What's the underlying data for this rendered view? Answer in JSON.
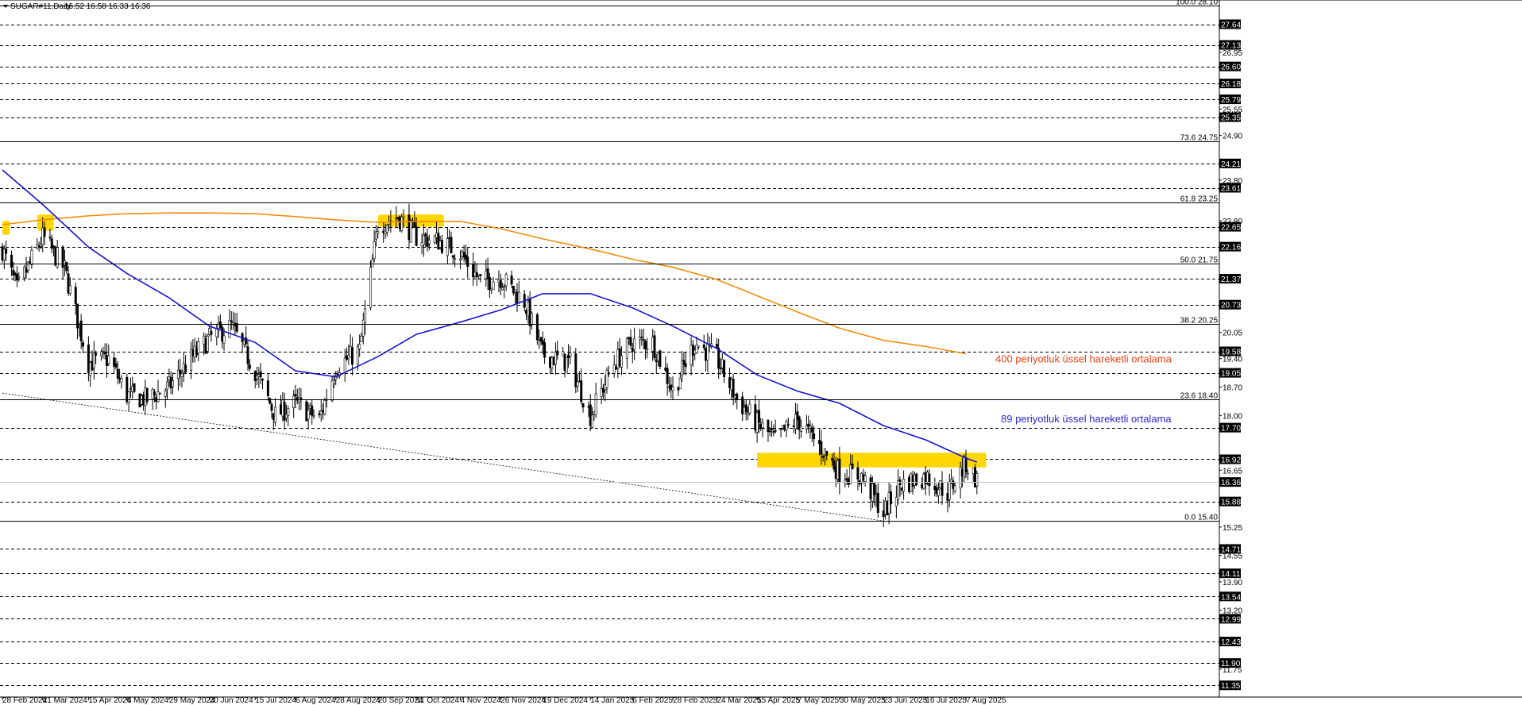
{
  "header": {
    "symbol": "SUGAR#11,Daily",
    "ohlc": "16.52 16.58 16.33 16.36"
  },
  "colors": {
    "background": "#ffffff",
    "grid": "#000000",
    "ema89": "#1414d2",
    "ema400": "#f28c0c",
    "zone": "#ffd600",
    "price_box": "#000000",
    "ann89": "#2a2ad4",
    "ann400": "#f2400f"
  },
  "chart_data": {
    "type": "candlestick",
    "title": "SUGAR#11,Daily",
    "ylim": [
      11.1,
      28.1
    ],
    "dates": [
      "28 Feb 2024",
      "21 Mar 2024",
      "15 Apr 2024",
      "6 May 2024",
      "29 May 2024",
      "20 Jun 2024",
      "15 Jul 2024",
      "6 Aug 2024",
      "28 Aug 2024",
      "20 Sep 2024",
      "11 Oct 2024",
      "4 Nov 2024",
      "26 Nov 2024",
      "19 Dec 2024",
      "14 Jan 2025",
      "6 Feb 2025",
      "28 Feb 2025",
      "24 Mar 2025",
      "15 Apr 2025",
      "7 May 2025",
      "30 May 2025",
      "23 Jun 2025",
      "16 Jul 2025",
      "7 Aug 2025"
    ],
    "y_ticks_dashed": [
      27.64,
      27.13,
      26.6,
      26.18,
      25.79,
      25.35,
      24.21,
      23.61,
      22.65,
      22.16,
      21.37,
      20.73,
      19.58,
      19.05,
      17.7,
      16.92,
      15.88,
      14.71,
      14.11,
      13.54,
      12.99,
      12.43,
      11.9,
      11.35
    ],
    "y_ticks_minor": [
      26.95,
      25.55,
      24.9,
      23.8,
      22.8,
      20.05,
      19.4,
      18.7,
      18.0,
      16.65,
      15.25,
      14.55,
      13.9,
      13.2,
      11.75
    ],
    "price_boxes": [
      27.64,
      27.13,
      26.6,
      26.18,
      25.79,
      25.35,
      24.21,
      23.61,
      22.65,
      22.16,
      21.37,
      20.73,
      19.58,
      19.05,
      17.7,
      16.92,
      16.36,
      15.88,
      14.71,
      14.11,
      13.54,
      12.99,
      12.43,
      11.9,
      11.35
    ],
    "fibonacci": [
      {
        "label": "100.0 28.10",
        "price": 28.1
      },
      {
        "label": "73.6 24.75",
        "price": 24.75
      },
      {
        "label": "61.8 23.25",
        "price": 23.25
      },
      {
        "label": "50.0 21.75",
        "price": 21.75
      },
      {
        "label": "38.2 20.25",
        "price": 20.25
      },
      {
        "label": "23.6 18.40",
        "price": 18.4
      },
      {
        "label": "0.0 15.40",
        "price": 15.4
      }
    ],
    "current_price": 16.36,
    "zones": [
      {
        "from": "28 Feb 2024",
        "from_offset": 0,
        "to_offset": 4,
        "low": 22.45,
        "high": 22.8
      },
      {
        "from": "21 Mar 2024",
        "from_offset": -3,
        "to_offset": 6,
        "low": 22.55,
        "high": 22.95
      },
      {
        "from": "20 Sep 2024",
        "from_offset": 0,
        "to_offset": 36,
        "low": 22.65,
        "high": 22.95
      },
      {
        "from": "15 Apr 2025",
        "from_offset": 0,
        "to_offset": 125,
        "low": 16.72,
        "high": 17.08
      }
    ],
    "ohlc_key_closes": [
      [
        "28 Feb 2024",
        22.1
      ],
      [
        "7 Mar 2024",
        21.1
      ],
      [
        "21 Mar 2024",
        22.4
      ],
      [
        "2 Apr 2024",
        21.6
      ],
      [
        "15 Apr 2024",
        19.3
      ],
      [
        "26 Apr 2024",
        19.4
      ],
      [
        "6 May 2024",
        18.5
      ],
      [
        "17 May 2024",
        18.4
      ],
      [
        "29 May 2024",
        18.7
      ],
      [
        "10 Jun 2024",
        19.4
      ],
      [
        "20 Jun 2024",
        19.9
      ],
      [
        "2 Jul 2024",
        20.2
      ],
      [
        "15 Jul 2024",
        19.1
      ],
      [
        "26 Jul 2024",
        18.0
      ],
      [
        "6 Aug 2024",
        18.3
      ],
      [
        "19 Aug 2024",
        17.9
      ],
      [
        "28 Aug 2024",
        19.2
      ],
      [
        "10 Sep 2024",
        19.6
      ],
      [
        "20 Sep 2024",
        22.7
      ],
      [
        "1 Oct 2024",
        22.9
      ],
      [
        "11 Oct 2024",
        22.4
      ],
      [
        "23 Oct 2024",
        22.3
      ],
      [
        "4 Nov 2024",
        22.0
      ],
      [
        "15 Nov 2024",
        21.3
      ],
      [
        "26 Nov 2024",
        21.4
      ],
      [
        "9 Dec 2024",
        20.8
      ],
      [
        "19 Dec 2024",
        19.5
      ],
      [
        "3 Jan 2025",
        19.3
      ],
      [
        "14 Jan 2025",
        18.0
      ],
      [
        "27 Jan 2025",
        19.3
      ],
      [
        "6 Feb 2025",
        19.8
      ],
      [
        "17 Feb 2025",
        19.8
      ],
      [
        "28 Feb 2025",
        18.6
      ],
      [
        "12 Mar 2025",
        19.8
      ],
      [
        "24 Mar 2025",
        19.4
      ],
      [
        "4 Apr 2025",
        18.4
      ],
      [
        "15 Apr 2025",
        17.8
      ],
      [
        "25 Apr 2025",
        17.4
      ],
      [
        "7 May 2025",
        17.9
      ],
      [
        "20 May 2025",
        17.2
      ],
      [
        "30 May 2025",
        16.6
      ],
      [
        "11 Jun 2025",
        16.5
      ],
      [
        "23 Jun 2025",
        15.6
      ],
      [
        "2 Jul 2025",
        16.3
      ],
      [
        "16 Jul 2025",
        16.5
      ],
      [
        "28 Jul 2025",
        16.1
      ],
      [
        "7 Aug 2025",
        16.8
      ],
      [
        "13 Aug 2025",
        16.4
      ]
    ],
    "ema89_points": [
      [
        "28 Feb 2024",
        24.05
      ],
      [
        "21 Mar 2024",
        23.2
      ],
      [
        "15 Apr 2024",
        22.15
      ],
      [
        "6 May 2024",
        21.5
      ],
      [
        "29 May 2024",
        20.9
      ],
      [
        "20 Jun 2024",
        20.2
      ],
      [
        "15 Jul 2024",
        19.8
      ],
      [
        "6 Aug 2024",
        19.1
      ],
      [
        "28 Aug 2024",
        18.95
      ],
      [
        "20 Sep 2024",
        19.45
      ],
      [
        "11 Oct 2024",
        20.0
      ],
      [
        "4 Nov 2024",
        20.3
      ],
      [
        "26 Nov 2024",
        20.6
      ],
      [
        "19 Dec 2024",
        21.0
      ],
      [
        "14 Jan 2025",
        21.0
      ],
      [
        "6 Feb 2025",
        20.65
      ],
      [
        "28 Feb 2025",
        20.2
      ],
      [
        "24 Mar 2025",
        19.65
      ],
      [
        "15 Apr 2025",
        19.0
      ],
      [
        "7 May 2025",
        18.6
      ],
      [
        "30 May 2025",
        18.3
      ],
      [
        "23 Jun 2025",
        17.75
      ],
      [
        "16 Jul 2025",
        17.4
      ],
      [
        "7 Aug 2025",
        16.95
      ],
      [
        "13 Aug 2025",
        16.85
      ]
    ],
    "ema400_points": [
      [
        "28 Feb 2024",
        22.7
      ],
      [
        "21 Mar 2024",
        22.82
      ],
      [
        "15 Apr 2024",
        22.92
      ],
      [
        "6 May 2024",
        22.97
      ],
      [
        "29 May 2024",
        22.99
      ],
      [
        "20 Jun 2024",
        22.99
      ],
      [
        "15 Jul 2024",
        22.97
      ],
      [
        "6 Aug 2024",
        22.9
      ],
      [
        "28 Aug 2024",
        22.82
      ],
      [
        "20 Sep 2024",
        22.76
      ],
      [
        "11 Oct 2024",
        22.78
      ],
      [
        "4 Nov 2024",
        22.78
      ],
      [
        "26 Nov 2024",
        22.6
      ],
      [
        "19 Dec 2024",
        22.35
      ],
      [
        "14 Jan 2025",
        22.1
      ],
      [
        "6 Feb 2025",
        21.85
      ],
      [
        "28 Feb 2025",
        21.65
      ],
      [
        "24 Mar 2025",
        21.35
      ],
      [
        "15 Apr 2025",
        20.95
      ],
      [
        "7 May 2025",
        20.55
      ],
      [
        "30 May 2025",
        20.15
      ],
      [
        "23 Jun 2025",
        19.85
      ],
      [
        "16 Jul 2025",
        19.7
      ],
      [
        "7 Aug 2025",
        19.52
      ]
    ],
    "trendline_points": [
      [
        "28 Feb 2024",
        18.55
      ],
      [
        "23 Jun 2025",
        15.4
      ]
    ],
    "annotations": [
      {
        "text": "400 periyotluk üssel hareketli ortalama",
        "price": 19.4,
        "color": "#f2400f"
      },
      {
        "text": "89 periyotluk üssel hareketli ortalama",
        "price": 17.93,
        "color": "#2a2ad4"
      }
    ]
  }
}
